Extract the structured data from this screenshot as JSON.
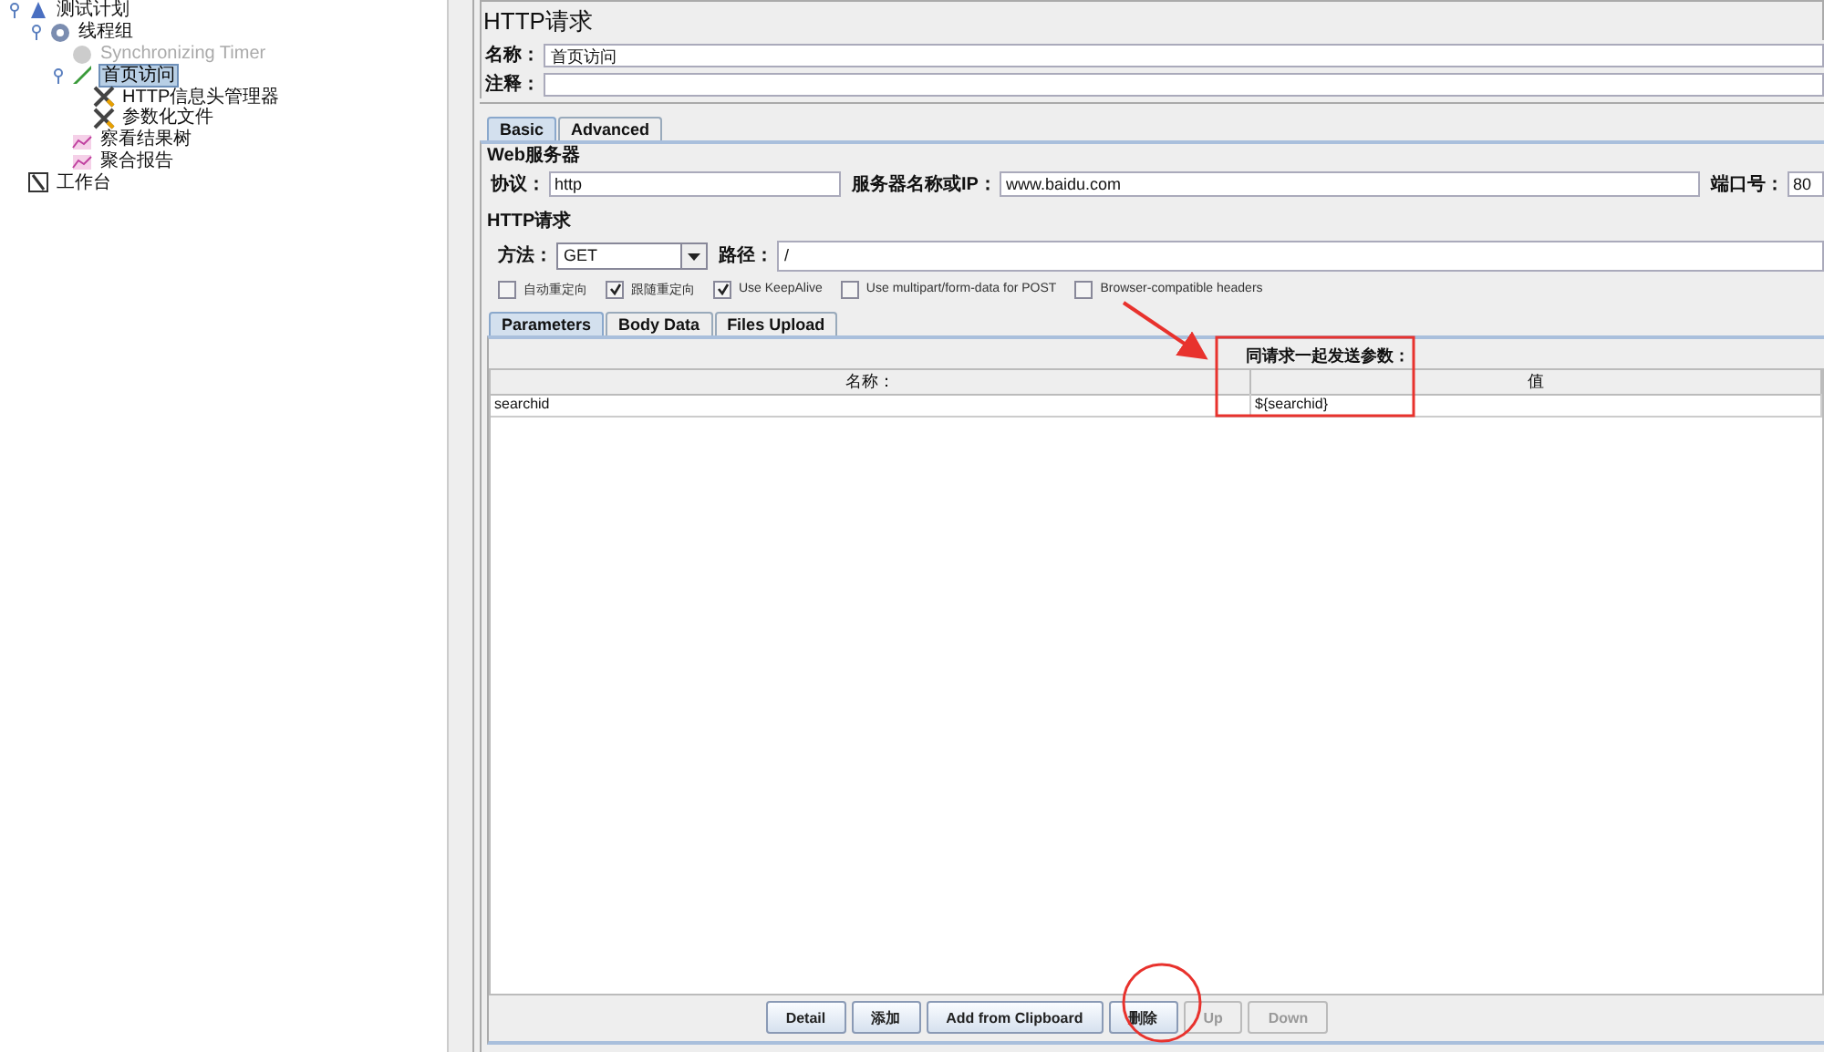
{
  "tree": [
    {
      "label": "测试计划",
      "kind": "plan",
      "expanded": true,
      "selected": false,
      "disabled": false,
      "children": [
        {
          "label": "线程组",
          "kind": "gear",
          "expanded": true,
          "selected": false,
          "disabled": false,
          "children": [
            {
              "label": "Synchronizing Timer",
              "kind": "timer",
              "selected": false,
              "disabled": true
            },
            {
              "label": "首页访问",
              "kind": "pen",
              "expanded": true,
              "selected": true,
              "disabled": false,
              "children": [
                {
                  "label": "HTTP信息头管理器",
                  "kind": "tools",
                  "selected": false,
                  "disabled": false
                },
                {
                  "label": "参数化文件",
                  "kind": "tools",
                  "selected": false,
                  "disabled": false
                }
              ]
            },
            {
              "label": "察看结果树",
              "kind": "graph",
              "selected": false,
              "disabled": false
            },
            {
              "label": "聚合报告",
              "kind": "graph",
              "selected": false,
              "disabled": false
            }
          ]
        }
      ]
    },
    {
      "label": "工作台",
      "kind": "bench",
      "selected": false,
      "disabled": false
    }
  ],
  "editor": {
    "title": "HTTP请求",
    "name_label": "名称：",
    "name_value": "首页访问",
    "comment_label": "注释：",
    "tabs": [
      {
        "label": "Basic",
        "selected": true
      },
      {
        "label": "Advanced",
        "selected": false
      }
    ],
    "web_server": {
      "legend": "Web服务器",
      "fields": [
        {
          "label": "协议：",
          "value": "http"
        },
        {
          "label": "服务器名称或IP：",
          "value": "www.baidu.com"
        },
        {
          "label": "端口号：",
          "value": "80"
        }
      ]
    },
    "http_request": {
      "legend": "HTTP请求",
      "method_label": "方法：",
      "method": "GET",
      "path_label": "路径：",
      "path": "/",
      "options": [
        {
          "label": "自动重定向",
          "checked": false
        },
        {
          "label": "跟随重定向",
          "checked": true
        },
        {
          "label": "Use KeepAlive",
          "checked": true
        },
        {
          "label": "Use multipart/form-data for POST",
          "checked": false
        },
        {
          "label": "Browser-compatible headers",
          "checked": false
        }
      ]
    },
    "param_tabs": [
      {
        "label": "Parameters",
        "selected": true
      },
      {
        "label": "Body Data",
        "selected": false
      },
      {
        "label": "Files Upload",
        "selected": false
      }
    ],
    "params_table": {
      "caption": "同请求一起发送参数：",
      "columns": [
        "名称：",
        "值"
      ],
      "rows": [
        [
          "searchid",
          "${searchid}"
        ]
      ]
    },
    "buttons": [
      {
        "label": "Detail",
        "disabled": false
      },
      {
        "label": "添加",
        "disabled": false
      },
      {
        "label": "Add from Clipboard",
        "disabled": false
      },
      {
        "label": "删除",
        "disabled": false
      },
      {
        "label": "Up",
        "disabled": true
      },
      {
        "label": "Down",
        "disabled": true
      }
    ]
  }
}
